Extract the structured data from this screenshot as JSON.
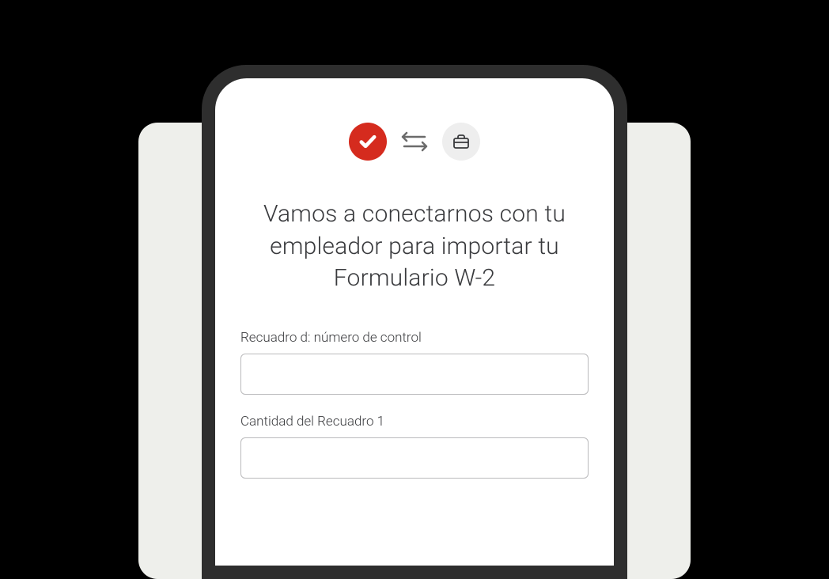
{
  "header": {
    "icons": {
      "app": "checkmark-icon",
      "transfer": "transfer-arrows-icon",
      "employer": "briefcase-icon"
    }
  },
  "main": {
    "heading": "Vamos a conectarnos con tu empleador para importar tu Formulario W-2"
  },
  "form": {
    "field1": {
      "label": "Recuadro d: número de control",
      "value": ""
    },
    "field2": {
      "label": "Cantidad del Recuadro 1",
      "value": ""
    }
  },
  "colors": {
    "brand_red": "#d52b1e",
    "bg_panel": "#eeefeb",
    "icon_gray": "#eeeeee"
  }
}
